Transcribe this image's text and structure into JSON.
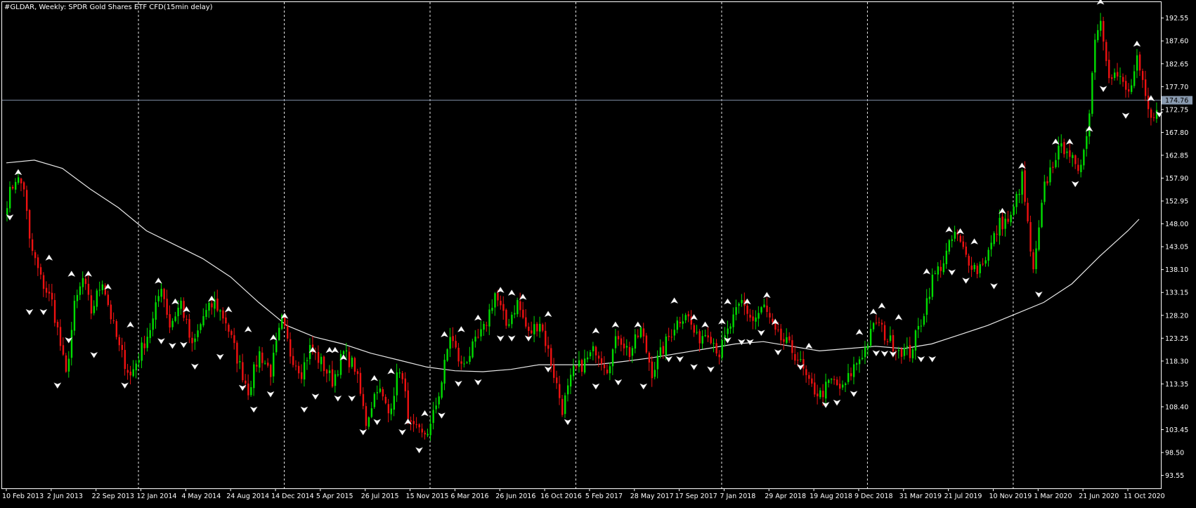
{
  "chart_data": {
    "type": "candlestick",
    "title": "#GLDAR, Weekly:  SPDR Gold Shares ETF CFD(15min delay)",
    "ylim": [
      90.75,
      196.0
    ],
    "y_ticks": [
      192.55,
      187.6,
      182.65,
      177.7,
      172.75,
      167.8,
      162.85,
      157.9,
      152.95,
      148.0,
      143.05,
      138.1,
      133.15,
      128.2,
      123.25,
      118.3,
      113.35,
      108.4,
      103.45,
      98.5,
      93.55
    ],
    "x_ticks": [
      {
        "label": "10 Feb 2013",
        "index": 0
      },
      {
        "label": "2 Jun 2013",
        "index": 16
      },
      {
        "label": "22 Sep 2013",
        "index": 32
      },
      {
        "label": "12 Jan 2014",
        "index": 48
      },
      {
        "label": "4 May 2014",
        "index": 64
      },
      {
        "label": "24 Aug 2014",
        "index": 80
      },
      {
        "label": "14 Dec 2014",
        "index": 96
      },
      {
        "label": "5 Apr 2015",
        "index": 112
      },
      {
        "label": "26 Jul 2015",
        "index": 128
      },
      {
        "label": "15 Nov 2015",
        "index": 144
      },
      {
        "label": "6 Mar 2016",
        "index": 160
      },
      {
        "label": "26 Jun 2016",
        "index": 176
      },
      {
        "label": "16 Oct 2016",
        "index": 192
      },
      {
        "label": "5 Feb 2017",
        "index": 208
      },
      {
        "label": "28 May 2017",
        "index": 224
      },
      {
        "label": "17 Sep 2017",
        "index": 240
      },
      {
        "label": "7 Jan 2018",
        "index": 256
      },
      {
        "label": "29 Apr 2018",
        "index": 272
      },
      {
        "label": "19 Aug 2018",
        "index": 288
      },
      {
        "label": "9 Dec 2018",
        "index": 304
      },
      {
        "label": "31 Mar 2019",
        "index": 320
      },
      {
        "label": "21 Jul 2019",
        "index": 336
      },
      {
        "label": "10 Nov 2019",
        "index": 352
      },
      {
        "label": "1 Mar 2020",
        "index": 368
      },
      {
        "label": "21 Jun 2020",
        "index": 384
      },
      {
        "label": "11 Oct 2020",
        "index": 400
      }
    ],
    "vertical_separators": [
      47,
      99,
      151,
      203,
      255,
      307,
      359
    ],
    "current_price": 174.76,
    "moving_average": [
      [
        0,
        161.2
      ],
      [
        10,
        161.8
      ],
      [
        20,
        160.0
      ],
      [
        30,
        155.5
      ],
      [
        40,
        151.5
      ],
      [
        50,
        146.5
      ],
      [
        60,
        143.5
      ],
      [
        70,
        140.5
      ],
      [
        80,
        136.5
      ],
      [
        90,
        131.0
      ],
      [
        100,
        126.0
      ],
      [
        110,
        123.5
      ],
      [
        120,
        122.0
      ],
      [
        130,
        120.0
      ],
      [
        140,
        118.5
      ],
      [
        150,
        117.0
      ],
      [
        160,
        116.2
      ],
      [
        170,
        116.0
      ],
      [
        180,
        116.5
      ],
      [
        190,
        117.5
      ],
      [
        200,
        117.5
      ],
      [
        210,
        117.5
      ],
      [
        220,
        118.2
      ],
      [
        230,
        119.0
      ],
      [
        240,
        120.0
      ],
      [
        250,
        121.0
      ],
      [
        260,
        122.0
      ],
      [
        270,
        122.5
      ],
      [
        280,
        121.5
      ],
      [
        290,
        120.5
      ],
      [
        300,
        121.0
      ],
      [
        310,
        121.5
      ],
      [
        320,
        121.0
      ],
      [
        330,
        122.0
      ],
      [
        340,
        124.0
      ],
      [
        350,
        126.0
      ],
      [
        360,
        128.5
      ],
      [
        370,
        131.0
      ],
      [
        380,
        135.0
      ],
      [
        390,
        141.0
      ],
      [
        400,
        146.5
      ],
      [
        404,
        149.0
      ]
    ],
    "price_path": [
      [
        0,
        153
      ],
      [
        3,
        158
      ],
      [
        6,
        156
      ],
      [
        8,
        144
      ],
      [
        12,
        136
      ],
      [
        16,
        131
      ],
      [
        18,
        125
      ],
      [
        21,
        115
      ],
      [
        24,
        130
      ],
      [
        27,
        136
      ],
      [
        30,
        129
      ],
      [
        34,
        136
      ],
      [
        37,
        128
      ],
      [
        40,
        121
      ],
      [
        44,
        115
      ],
      [
        48,
        121
      ],
      [
        52,
        127
      ],
      [
        55,
        135
      ],
      [
        58,
        126
      ],
      [
        62,
        131
      ],
      [
        66,
        121
      ],
      [
        70,
        128
      ],
      [
        74,
        131
      ],
      [
        78,
        127
      ],
      [
        82,
        119
      ],
      [
        86,
        112
      ],
      [
        90,
        120
      ],
      [
        94,
        116
      ],
      [
        98,
        127
      ],
      [
        101,
        120
      ],
      [
        105,
        116
      ],
      [
        108,
        121
      ],
      [
        112,
        118
      ],
      [
        116,
        114
      ],
      [
        120,
        120
      ],
      [
        124,
        117
      ],
      [
        128,
        105
      ],
      [
        132,
        113
      ],
      [
        136,
        107
      ],
      [
        140,
        117
      ],
      [
        144,
        104
      ],
      [
        148,
        102
      ],
      [
        151,
        104
      ],
      [
        155,
        114
      ],
      [
        158,
        124
      ],
      [
        162,
        117
      ],
      [
        166,
        121
      ],
      [
        170,
        125
      ],
      [
        174,
        133
      ],
      [
        178,
        126
      ],
      [
        182,
        131
      ],
      [
        186,
        124
      ],
      [
        190,
        127
      ],
      [
        194,
        118
      ],
      [
        198,
        108
      ],
      [
        202,
        116
      ],
      [
        206,
        118
      ],
      [
        210,
        121
      ],
      [
        214,
        117
      ],
      [
        218,
        124
      ],
      [
        222,
        120
      ],
      [
        226,
        125
      ],
      [
        230,
        116
      ],
      [
        234,
        121
      ],
      [
        238,
        126
      ],
      [
        242,
        129
      ],
      [
        246,
        123
      ],
      [
        250,
        125
      ],
      [
        254,
        120
      ],
      [
        258,
        126
      ],
      [
        262,
        131
      ],
      [
        266,
        127
      ],
      [
        270,
        130
      ],
      [
        274,
        124
      ],
      [
        278,
        122
      ],
      [
        282,
        119
      ],
      [
        286,
        113
      ],
      [
        290,
        111
      ],
      [
        294,
        114
      ],
      [
        298,
        112
      ],
      [
        302,
        117
      ],
      [
        306,
        121
      ],
      [
        310,
        127
      ],
      [
        314,
        123
      ],
      [
        318,
        121
      ],
      [
        322,
        120
      ],
      [
        326,
        127
      ],
      [
        330,
        136
      ],
      [
        334,
        140
      ],
      [
        338,
        146
      ],
      [
        342,
        141
      ],
      [
        346,
        138
      ],
      [
        350,
        142
      ],
      [
        354,
        148
      ],
      [
        358,
        149
      ],
      [
        362,
        158
      ],
      [
        366,
        137
      ],
      [
        370,
        156
      ],
      [
        374,
        163
      ],
      [
        378,
        165
      ],
      [
        382,
        158
      ],
      [
        386,
        172
      ],
      [
        388,
        189
      ],
      [
        390,
        192
      ],
      [
        393,
        181
      ],
      [
        396,
        180
      ],
      [
        400,
        176
      ],
      [
        403,
        183
      ],
      [
        406,
        175
      ],
      [
        408,
        170
      ],
      [
        410,
        174
      ]
    ],
    "fractal_up": [
      [
        4,
        158.6
      ],
      [
        15,
        140.1
      ],
      [
        23,
        136.6
      ],
      [
        29,
        136.6
      ],
      [
        36,
        133.8
      ],
      [
        44,
        125.6
      ],
      [
        54,
        135.1
      ],
      [
        60,
        130.6
      ],
      [
        64,
        128.9
      ],
      [
        73,
        131.2
      ],
      [
        79,
        128.9
      ],
      [
        86,
        124.6
      ],
      [
        95,
        122.8
      ],
      [
        99,
        127.5
      ],
      [
        109,
        120.1
      ],
      [
        115,
        120.1
      ],
      [
        117,
        120.1
      ],
      [
        120,
        118.5
      ],
      [
        131,
        114.0
      ],
      [
        137,
        115.5
      ],
      [
        143,
        104.6
      ],
      [
        149,
        106.4
      ],
      [
        156,
        123.5
      ],
      [
        162,
        124.6
      ],
      [
        168,
        127.1
      ],
      [
        176,
        133.1
      ],
      [
        180,
        132.5
      ],
      [
        184,
        131.6
      ],
      [
        193,
        127.9
      ],
      [
        210,
        124.3
      ],
      [
        217,
        125.6
      ],
      [
        225,
        125.6
      ],
      [
        238,
        130.8
      ],
      [
        245,
        127.2
      ],
      [
        249,
        125.6
      ],
      [
        255,
        126.3
      ],
      [
        257,
        130.6
      ],
      [
        264,
        130.6
      ],
      [
        271,
        132.0
      ],
      [
        274,
        126.2
      ],
      [
        286,
        121.0
      ],
      [
        304,
        124.0
      ],
      [
        309,
        128.4
      ],
      [
        312,
        129.7
      ],
      [
        318,
        127.2
      ],
      [
        328,
        137.1
      ],
      [
        336,
        146.2
      ],
      [
        340,
        145.8
      ],
      [
        345,
        143.6
      ],
      [
        355,
        150.2
      ],
      [
        362,
        160.0
      ],
      [
        374,
        165.2
      ],
      [
        379,
        165.2
      ],
      [
        386,
        168.0
      ],
      [
        390,
        195.5
      ],
      [
        403,
        186.4
      ],
      [
        408,
        174.6
      ]
    ],
    "fractal_down": [
      [
        1,
        150.0
      ],
      [
        8,
        129.5
      ],
      [
        13,
        129.5
      ],
      [
        18,
        113.6
      ],
      [
        22,
        123.4
      ],
      [
        31,
        120.2
      ],
      [
        42,
        113.6
      ],
      [
        55,
        123.2
      ],
      [
        59,
        122.2
      ],
      [
        63,
        122.4
      ],
      [
        67,
        117.7
      ],
      [
        76,
        119.8
      ],
      [
        84,
        113.1
      ],
      [
        88,
        108.4
      ],
      [
        94,
        111.7
      ],
      [
        106,
        108.4
      ],
      [
        110,
        111.2
      ],
      [
        118,
        110.8
      ],
      [
        123,
        110.8
      ],
      [
        127,
        103.5
      ],
      [
        132,
        105.7
      ],
      [
        141,
        103.5
      ],
      [
        147,
        99.6
      ],
      [
        155,
        107.1
      ],
      [
        161,
        114.0
      ],
      [
        168,
        114.3
      ],
      [
        176,
        123.8
      ],
      [
        180,
        123.8
      ],
      [
        186,
        123.8
      ],
      [
        193,
        117.1
      ],
      [
        200,
        105.7
      ],
      [
        210,
        113.4
      ],
      [
        218,
        114.3
      ],
      [
        227,
        113.4
      ],
      [
        236,
        119.3
      ],
      [
        240,
        119.3
      ],
      [
        245,
        117.6
      ],
      [
        251,
        117.1
      ],
      [
        257,
        123.4
      ],
      [
        262,
        123.0
      ],
      [
        265,
        123.0
      ],
      [
        269,
        125.0
      ],
      [
        275,
        120.8
      ],
      [
        283,
        117.6
      ],
      [
        292,
        109.4
      ],
      [
        296,
        109.9
      ],
      [
        302,
        111.8
      ],
      [
        310,
        120.6
      ],
      [
        313,
        120.5
      ],
      [
        316,
        120.4
      ],
      [
        326,
        119.3
      ],
      [
        330,
        119.3
      ],
      [
        337,
        138.1
      ],
      [
        342,
        136.3
      ],
      [
        352,
        135.1
      ],
      [
        368,
        133.3
      ],
      [
        381,
        157.2
      ],
      [
        391,
        177.8
      ],
      [
        399,
        172.0
      ],
      [
        411,
        172.3
      ]
    ]
  }
}
